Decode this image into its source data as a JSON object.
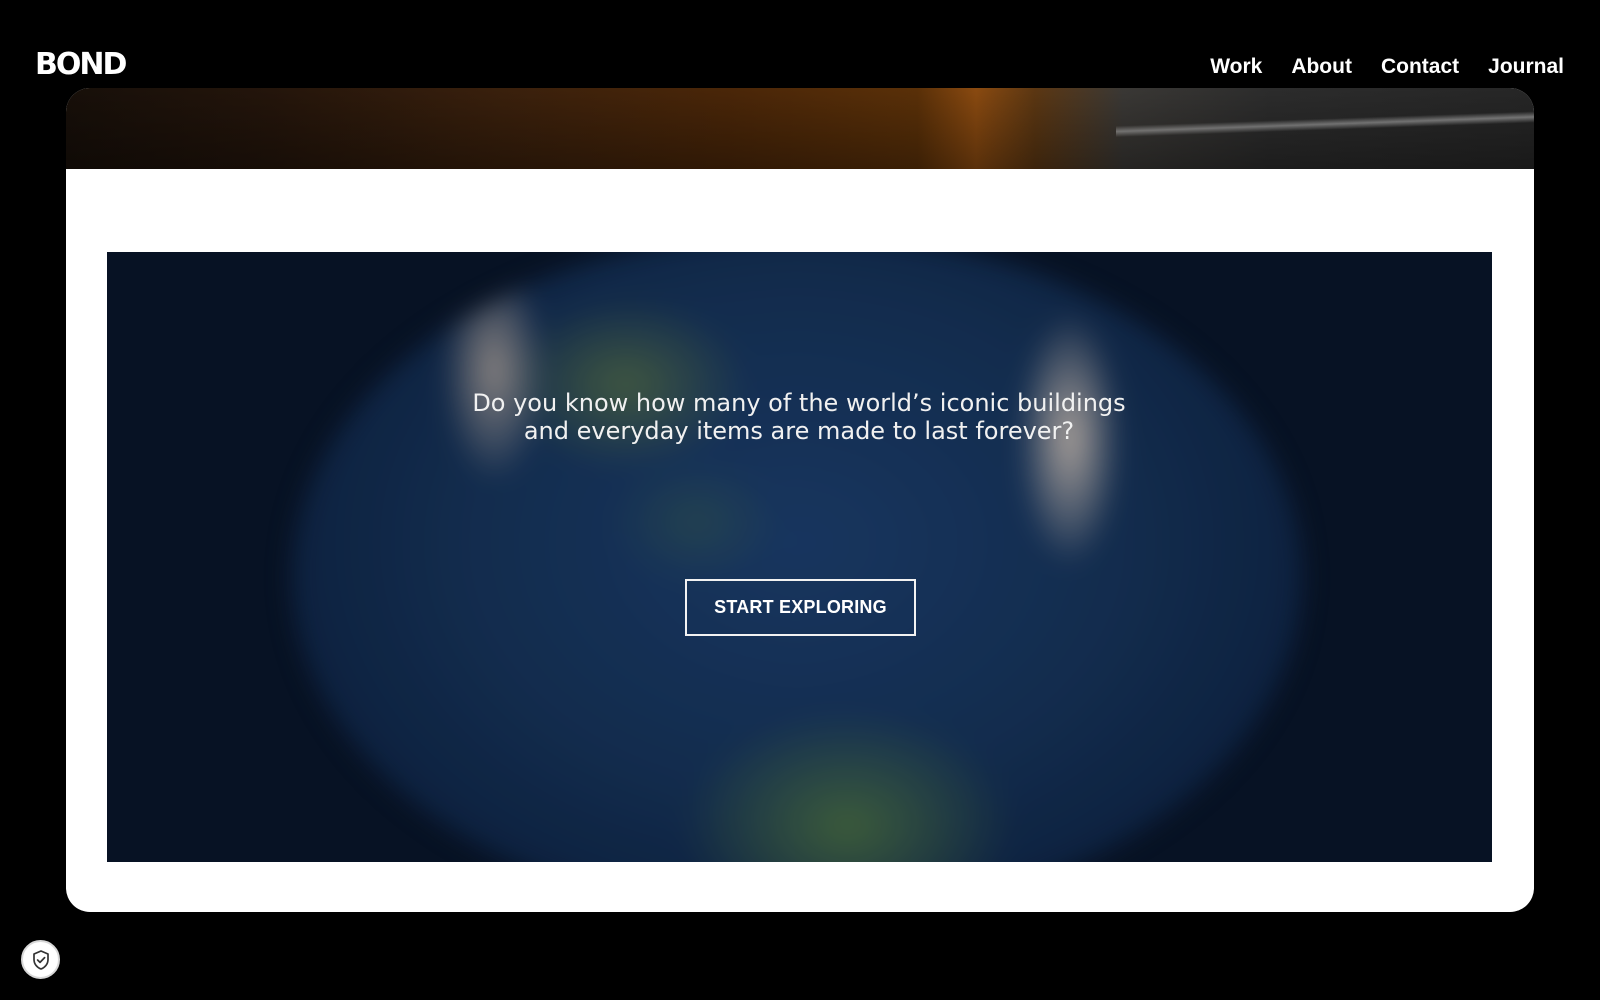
{
  "brand": {
    "logo_text": "BOND"
  },
  "nav": {
    "items": [
      {
        "label": "Work"
      },
      {
        "label": "About"
      },
      {
        "label": "Contact"
      },
      {
        "label": "Journal"
      }
    ]
  },
  "hero": {
    "headline": "Do you know how many of the world’s iconic buildings and everyday items are made to last forever?",
    "cta_label": "START EXPLORING"
  },
  "icons": {
    "privacy": "shield-check-icon"
  },
  "colors": {
    "page_background": "#000000",
    "card_background": "#ffffff",
    "text_light": "#ffffff",
    "globe_deep_blue": "#0e2444"
  }
}
